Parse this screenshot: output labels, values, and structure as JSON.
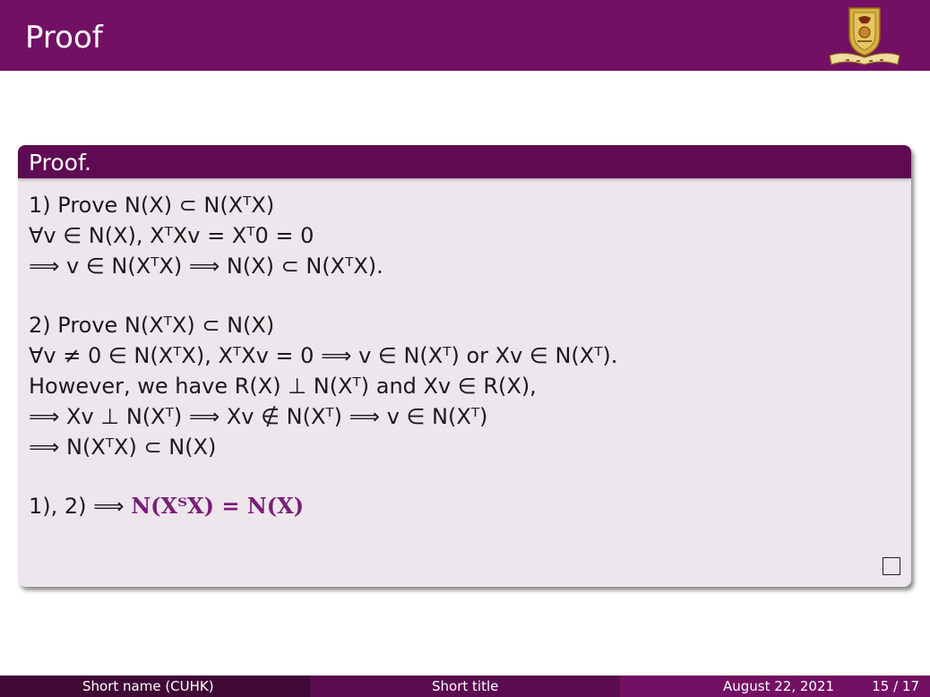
{
  "slide": {
    "title": "Proof"
  },
  "block": {
    "title": "Proof.",
    "part1": {
      "label": "1) Prove N(X) ⊂ N(XᵀX)",
      "line2": "∀v ∈ N(X), XᵀXv = Xᵀ0 = 0",
      "line3": "⟹ v ∈ N(XᵀX) ⟹ N(X) ⊂ N(XᵀX)."
    },
    "part2": {
      "label": "2) Prove N(XᵀX) ⊂ N(X)",
      "line2": "∀v ≠ 0 ∈ N(XᵀX), XᵀXv = 0 ⟹ v ∈ N(Xᵀ) or Xv ∈ N(Xᵀ).",
      "line3": "However, we have R(X) ⊥ N(Xᵀ) and Xv ∈ R(X),",
      "line4": "⟹ Xv ⊥ N(Xᵀ) ⟹ Xv ∉ N(Xᵀ) ⟹ v ∈ N(Xᵀ)",
      "line5": "⟹ N(XᵀX) ⊂ N(X)"
    },
    "conclusion": {
      "prefix": "1), 2) ⟹",
      "result": "N(XᵀX) = N(X)"
    }
  },
  "footer": {
    "author": "Short name  (CUHK)",
    "short_title": "Short title",
    "date": "August 22, 2021",
    "page": "15 / 17"
  },
  "colors": {
    "header": "#731064",
    "block_header": "#5f0b53",
    "block_body": "#ede6ed",
    "accent": "#7a1e78"
  },
  "icons": {
    "logo": "cuhk-crest-icon",
    "qed": "qed-square-icon"
  }
}
